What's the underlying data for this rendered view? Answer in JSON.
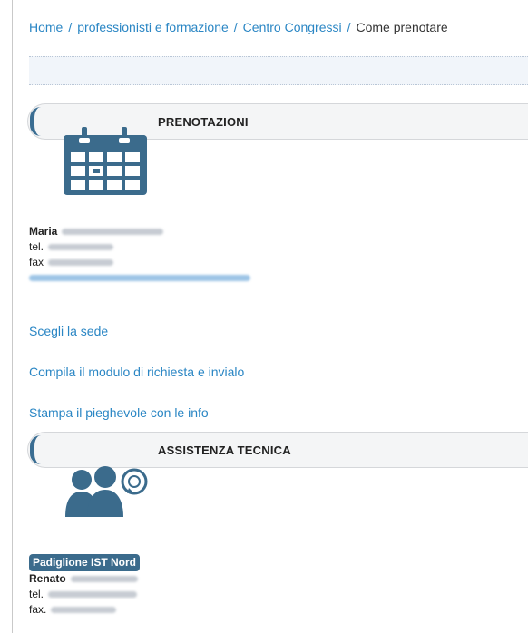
{
  "breadcrumb": {
    "items": [
      "Home",
      "professionisti e formazione",
      "Centro Congressi"
    ],
    "current": "Come prenotare",
    "separator": "/"
  },
  "sections": {
    "prenotazioni": {
      "title": "PRENOTAZIONI",
      "icon": "calendar-icon",
      "contact": {
        "name": "Maria",
        "tel_label": "tel.",
        "fax_label": "fax"
      },
      "links": [
        "Scegli la sede",
        "Compila il modulo di richiesta e invialo",
        "Stampa il pieghevole con le info"
      ]
    },
    "assistenza": {
      "title": "ASSISTENZA TECNICA",
      "icon": "support-team-icon",
      "badge": "Padiglione IST Nord",
      "contact": {
        "name": "Renato",
        "tel_label": "tel.",
        "fax_label": "fax."
      }
    }
  },
  "colors": {
    "link": "#2a86c4",
    "icon": "#3b6b8c",
    "header_bg": "#f4f5f6"
  }
}
